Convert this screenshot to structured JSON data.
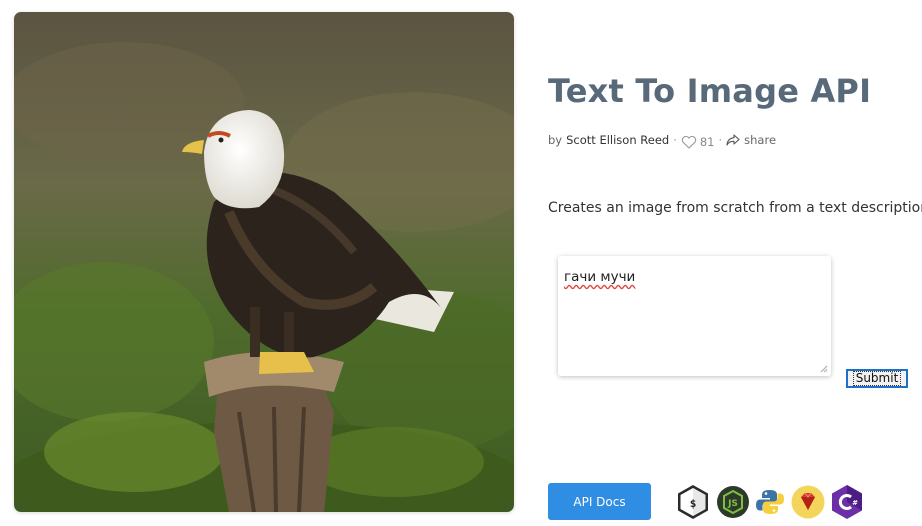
{
  "page": {
    "title": "Text To Image API",
    "byline": {
      "prefix": "by",
      "author": "Scott Ellison Reed",
      "likes": "81",
      "share_label": "share"
    },
    "description": "Creates an image from scratch from a text description."
  },
  "form": {
    "prompt_value": "гачи мучи",
    "submit_label": "Submit"
  },
  "footer": {
    "docs_label": "API Docs",
    "languages": [
      "bash-icon",
      "nodejs-icon",
      "python-icon",
      "ruby-icon",
      "csharp-icon"
    ]
  },
  "colors": {
    "title": "#586a79",
    "docs_button": "#2f8ee3",
    "submit_focus": "#1e6fc9"
  }
}
